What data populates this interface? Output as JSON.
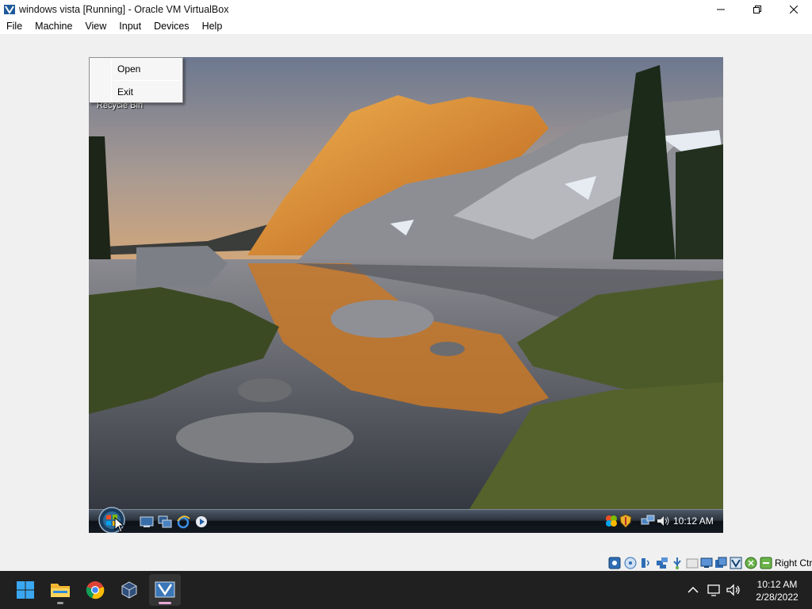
{
  "window": {
    "title": "windows vista [Running] - Oracle VM VirtualBox",
    "controls": [
      "minimize-icon",
      "restore-icon",
      "close-icon"
    ]
  },
  "menubar": [
    "File",
    "Machine",
    "View",
    "Input",
    "Devices",
    "Help"
  ],
  "guest": {
    "desktop_icon_label": "Recycle Bin",
    "context_menu": [
      "Open",
      "Exit"
    ],
    "taskbar": {
      "quick_launch": [
        "show-desktop-icon",
        "switch-windows-icon",
        "internet-explorer-icon",
        "media-player-icon"
      ],
      "tray": [
        "network-sync-icon",
        "security-shield-icon",
        "network-icon",
        "volume-icon"
      ],
      "clock": "10:12 AM"
    }
  },
  "vbox_status": {
    "icons": [
      "hard-disk-icon",
      "optical-drive-icon",
      "audio-icon",
      "network-adapter-icon",
      "usb-icon",
      "shared-folders-icon",
      "display-icon",
      "video-capture-icon",
      "virtualization-icon",
      "mouse-integration-icon",
      "keyboard-icon"
    ],
    "host_key": "Right Ctrl"
  },
  "host_taskbar": {
    "apps": [
      "windows-start-icon",
      "file-explorer-icon",
      "chrome-icon",
      "virtualbox-manager-icon",
      "vista-vm-icon"
    ],
    "tray": [
      "chevron-up-icon",
      "network-monitor-icon",
      "speaker-icon"
    ],
    "time": "10:12 AM",
    "date": "2/28/2022"
  },
  "colors": {
    "host_taskbar": "#202020",
    "sky_top": "#6c7890",
    "sky_horizon": "#d6a878",
    "sunlit_rock": "#e6902e",
    "active_indicator": "#e8a6d6"
  }
}
